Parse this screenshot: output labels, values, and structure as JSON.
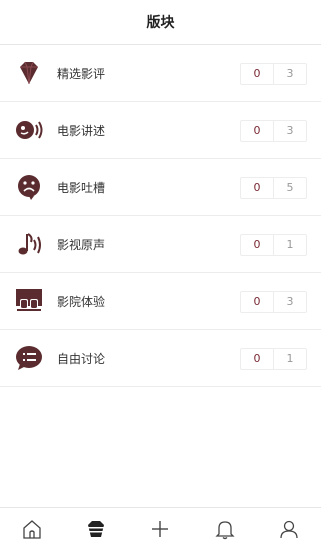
{
  "header": {
    "title": "版块"
  },
  "forums": [
    {
      "name": "精选影评",
      "icon": "gem-icon",
      "new_count": "0",
      "total_count": "3"
    },
    {
      "name": "电影讲述",
      "icon": "speaking-head-icon",
      "new_count": "0",
      "total_count": "3"
    },
    {
      "name": "电影吐槽",
      "icon": "sad-face-icon",
      "new_count": "0",
      "total_count": "5"
    },
    {
      "name": "影视原声",
      "icon": "music-note-icon",
      "new_count": "0",
      "total_count": "1"
    },
    {
      "name": "影院体验",
      "icon": "cinema-seats-icon",
      "new_count": "0",
      "total_count": "3"
    },
    {
      "name": "自由讨论",
      "icon": "chat-bubble-icon",
      "new_count": "0",
      "total_count": "1"
    }
  ],
  "tabbar": [
    {
      "icon": "home-icon",
      "active": false
    },
    {
      "icon": "forum-icon",
      "active": true
    },
    {
      "icon": "plus-icon",
      "active": false
    },
    {
      "icon": "bell-icon",
      "active": false
    },
    {
      "icon": "user-icon",
      "active": false
    }
  ],
  "colors": {
    "accent": "#5b2c2f",
    "new_count": "#7a2a35",
    "muted": "#999999"
  }
}
